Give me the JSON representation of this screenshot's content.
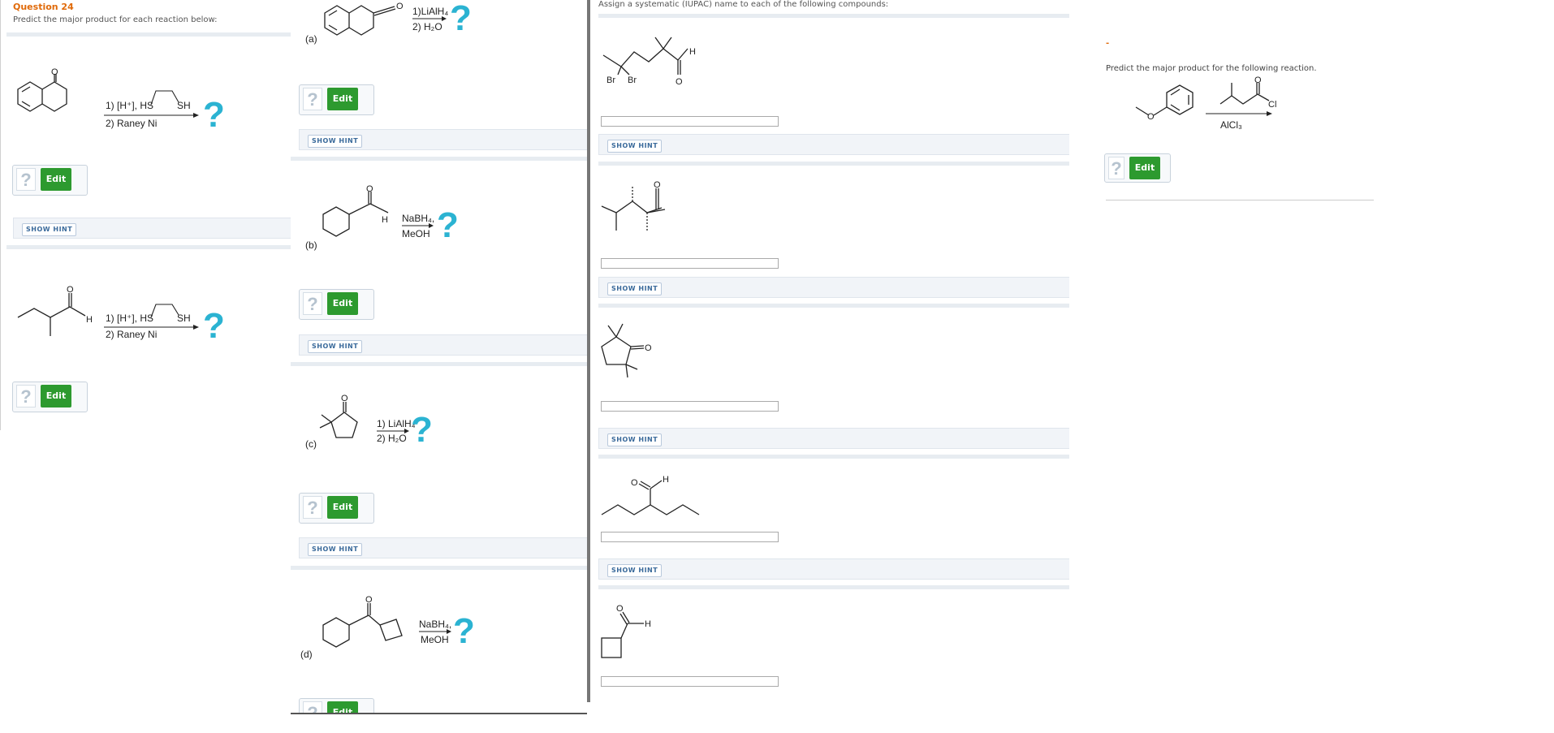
{
  "question": {
    "number": "Question 24",
    "instruction": "Predict the major product for each reaction below:"
  },
  "colors": {
    "accent_title": "#e06a0a",
    "edit_green": "#2d9a2f",
    "question_mark_cyan": "#2bb3d2",
    "hint_text": "#3a6a9b"
  },
  "left_panel": {
    "reaction1": {
      "reagent_line1": "1) [H⁺], HS",
      "reagent_sh": "SH",
      "reagent_line2": "2) Raney Ni",
      "atom_o": "O"
    },
    "reaction2": {
      "reagent_line1": "1) [H⁺], HS",
      "reagent_sh": "SH",
      "reagent_line2": "2) Raney Ni",
      "atom_o": "O",
      "atom_h": "H"
    },
    "edit_label": "Edit",
    "unknown_label": "?",
    "hint_label": "SHOW HINT"
  },
  "middle_panel": {
    "a": {
      "label": "(a)",
      "reagent1": "1)LiAlH₄",
      "reagent2": "2) H₂O",
      "atom_o": "O"
    },
    "b": {
      "label": "(b)",
      "reagent1": "NaBH₄,",
      "reagent2": "MeOH",
      "atom_o": "O",
      "atom_h": "H"
    },
    "c": {
      "label": "(c)",
      "reagent1": "1) LiAlH₄",
      "reagent2": "2) H₂O",
      "atom_o": "O"
    },
    "d": {
      "label": "(d)",
      "reagent1": "NaBH₄,",
      "reagent2": "MeOH",
      "atom_o": "O"
    },
    "edit_label": "Edit",
    "unknown_label": "?",
    "hint_label": "SHOW HINT"
  },
  "right_panel": {
    "instruction": "Assign a systematic (IUPAC) name to each of the following compounds:",
    "compound1": {
      "br1": "Br",
      "br2": "Br",
      "atom_o": "O",
      "atom_h": "H"
    },
    "compound2": {
      "atom_o": "O"
    },
    "compound3": {
      "atom_o": "O"
    },
    "compound4": {
      "atom_o": "O",
      "atom_h": "H"
    },
    "compound5": {
      "atom_o": "O",
      "atom_h": "H"
    },
    "hint_label": "SHOW HINT",
    "answers": [
      "",
      "",
      "",
      "",
      ""
    ]
  },
  "far_right_panel": {
    "dash": "-",
    "instruction": "Predict the major product for the following reaction.",
    "reagent": "AlCl₃",
    "atom_o": "O",
    "atom_o2": "O",
    "atom_cl": "Cl",
    "edit_label": "Edit",
    "unknown_label": "?"
  }
}
